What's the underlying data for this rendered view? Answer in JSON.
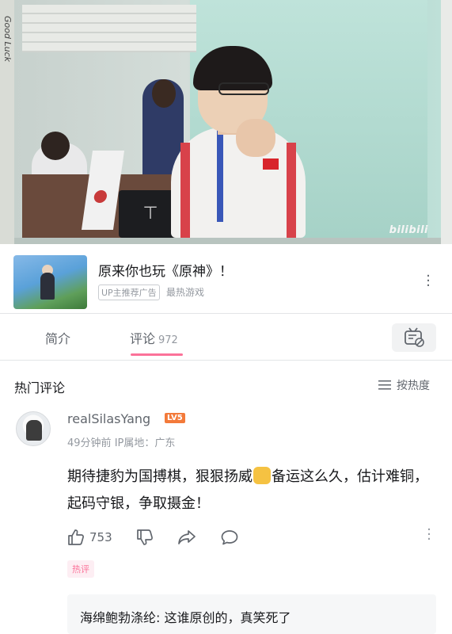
{
  "video": {
    "side_text": "Good Luck",
    "watermark_top": "",
    "watermark_brand": "bilibili"
  },
  "ad": {
    "title": "原来你也玩《原神》！",
    "tag": "UP主推荐广告",
    "subtitle": "最热游戏"
  },
  "tabs": {
    "intro_label": "简介",
    "comments_label": "评论",
    "comments_count": "972"
  },
  "comments_section": {
    "title": "热门评论",
    "sort_label": "按热度"
  },
  "comment": {
    "username": "realSilasYang",
    "level": "LV5",
    "time": "49分钟前",
    "ip_label": "IP属地：广东",
    "text_part1": "期待捷豹为国搏棋，狠狠扬威",
    "text_part2": "备运这么久，估计难铜，起码守银，争取摄金！",
    "like_count": "753",
    "hot_badge": "热评"
  },
  "reply": {
    "author": "海绵鲍勃涤纶:",
    "text": " 这谁原创的，真笑死了"
  },
  "colors": {
    "accent": "#fb7299",
    "text_primary": "#18191c",
    "text_secondary": "#61666d",
    "text_muted": "#9499a0"
  }
}
